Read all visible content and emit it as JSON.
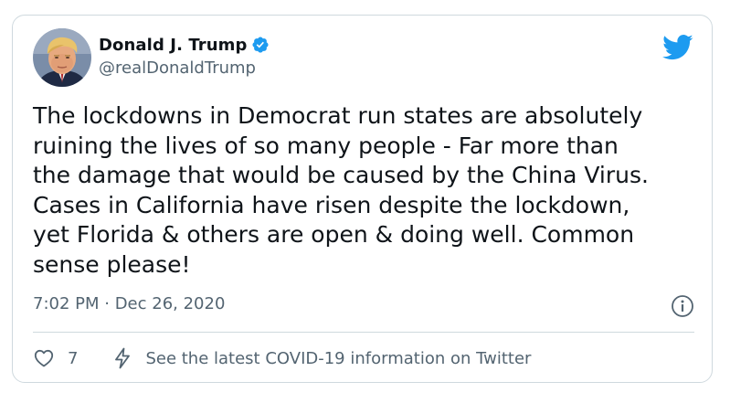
{
  "tweet": {
    "author": {
      "display_name": "Donald J. Trump",
      "handle": "@realDonaldTrump",
      "verified": true
    },
    "text": "The lockdowns in Democrat run states are absolutely\nruining the lives of so many people - Far more than\nthe damage that would be caused by the China Virus.\nCases in California have risen despite the lockdown,\nyet Florida & others are open & doing well. Common\nsense please!",
    "timestamp": "7:02 PM · Dec 26, 2020",
    "likes": "7",
    "covid_notice": "See the latest COVID-19 information on Twitter"
  },
  "icons": {
    "verified": "verified-badge-icon",
    "brand": "twitter-bird-icon",
    "info": "info-icon",
    "like": "heart-icon",
    "notice": "bolt-icon"
  },
  "colors": {
    "accent": "#1d9bf0",
    "text_primary": "#0f1419",
    "text_secondary": "#536471",
    "border": "#cfd9de"
  }
}
